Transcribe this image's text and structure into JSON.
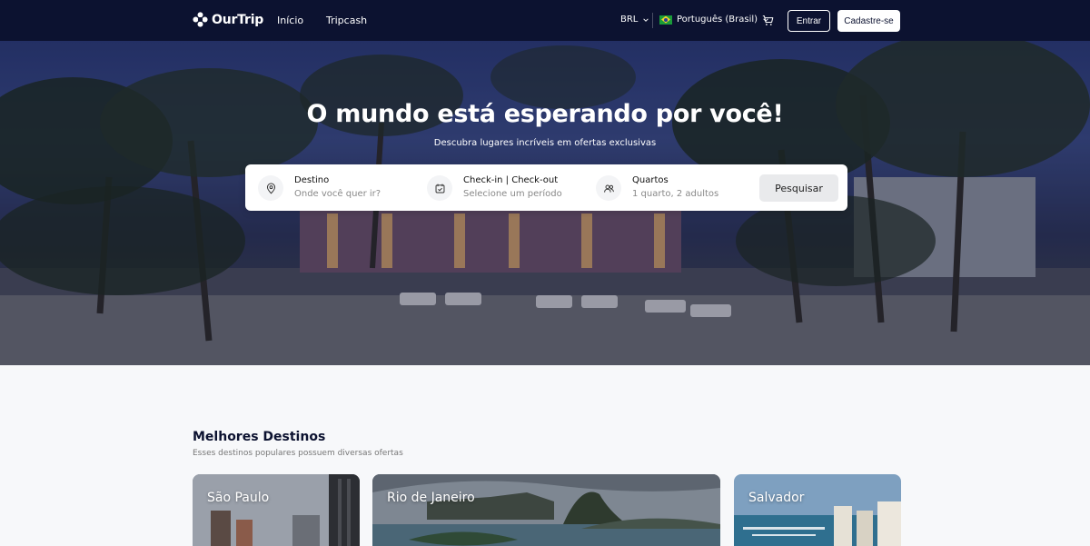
{
  "header": {
    "brand": "OurTrip",
    "nav": [
      {
        "label": "Início"
      },
      {
        "label": "Tripcash"
      }
    ],
    "currency": "BRL",
    "language": "Português (Brasil)",
    "login_label": "Entrar",
    "signup_label": "Cadastre-se"
  },
  "hero": {
    "title": "O mundo está esperando por você!",
    "subtitle": "Descubra lugares incríveis em ofertas exclusivas"
  },
  "search": {
    "destination": {
      "label": "Destino",
      "placeholder": "Onde você quer ir?"
    },
    "dates": {
      "label": "Check-in | Check-out",
      "placeholder": "Selecione um período"
    },
    "rooms": {
      "label": "Quartos",
      "value": "1 quarto, 2 adultos"
    },
    "button_label": "Pesquisar"
  },
  "destinations": {
    "title": "Melhores Destinos",
    "subtitle": "Esses destinos populares possuem diversas ofertas",
    "cards": [
      {
        "name": "São Paulo"
      },
      {
        "name": "Rio de Janeiro"
      },
      {
        "name": "Salvador"
      }
    ]
  },
  "colors": {
    "header_bg": "#0c1230",
    "brand_text": "#0c1230"
  }
}
